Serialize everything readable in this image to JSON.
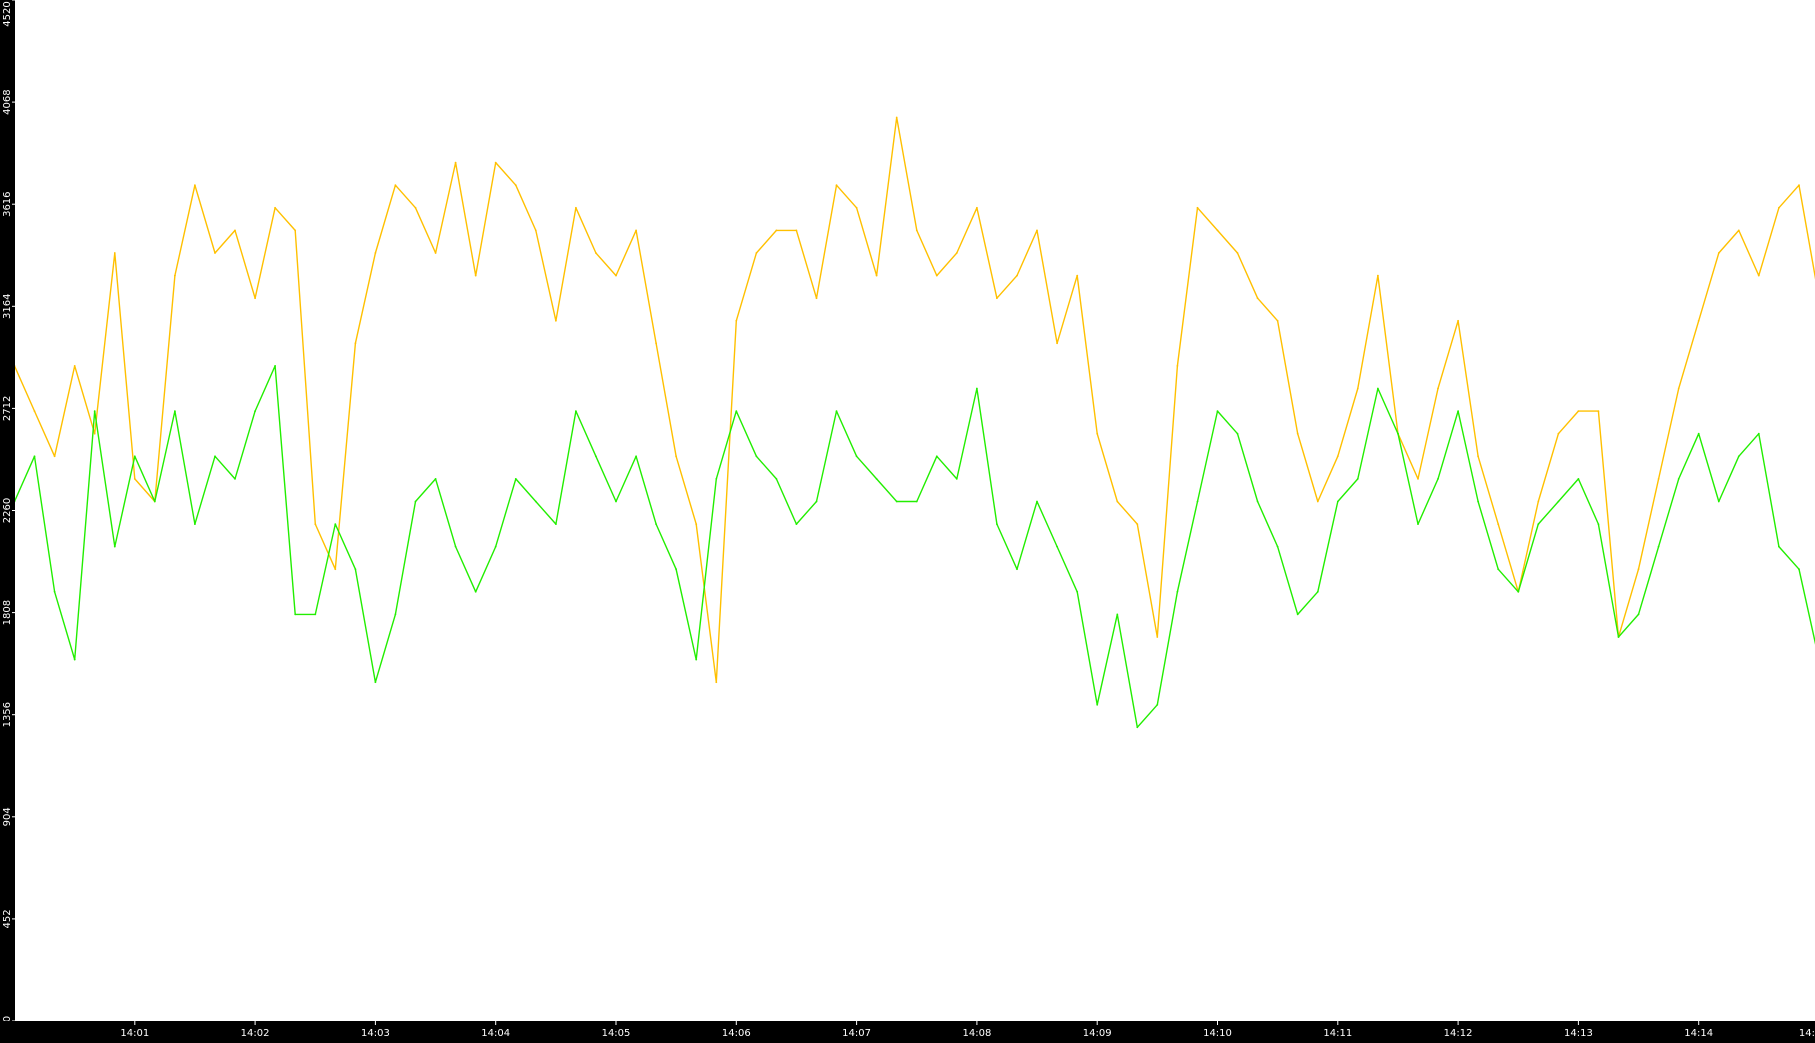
{
  "chart_data": {
    "type": "line",
    "title": "",
    "xlabel": "",
    "ylabel": "",
    "ylim": [
      0,
      4520
    ],
    "xlim": [
      "14:00:00",
      "14:15:00"
    ],
    "grid": false,
    "legend": "none",
    "y_ticks": [
      "0",
      "452",
      "904",
      "1356",
      "1808",
      "2260",
      "2712",
      "3164",
      "3616",
      "4068",
      "4520"
    ],
    "y_tick_values": [
      0,
      452,
      904,
      1356,
      1808,
      2260,
      2712,
      3164,
      3616,
      4068,
      4520
    ],
    "x_ticks": [
      "14:01",
      "14:02",
      "14:03",
      "14:04",
      "14:05",
      "14:06",
      "14:07",
      "14:08",
      "14:09",
      "14:10",
      "14:11",
      "14:12",
      "14:13",
      "14:14",
      "14:"
    ],
    "x_tick_times": [
      "14:01:00",
      "14:02:00",
      "14:03:00",
      "14:04:00",
      "14:05:00",
      "14:06:00",
      "14:07:00",
      "14:08:00",
      "14:09:00",
      "14:10:00",
      "14:11:00",
      "14:12:00",
      "14:13:00",
      "14:14:00",
      "14:15:00"
    ],
    "x": [
      "14:00:00",
      "14:00:10",
      "14:00:20",
      "14:00:30",
      "14:00:40",
      "14:00:50",
      "14:01:00",
      "14:01:10",
      "14:01:20",
      "14:01:30",
      "14:01:40",
      "14:01:50",
      "14:02:00",
      "14:02:10",
      "14:02:20",
      "14:02:30",
      "14:02:40",
      "14:02:50",
      "14:03:00",
      "14:03:10",
      "14:03:20",
      "14:03:30",
      "14:03:40",
      "14:03:50",
      "14:04:00",
      "14:04:10",
      "14:04:20",
      "14:04:30",
      "14:04:40",
      "14:04:50",
      "14:05:00",
      "14:05:10",
      "14:05:20",
      "14:05:30",
      "14:05:40",
      "14:05:50",
      "14:06:00",
      "14:06:10",
      "14:06:20",
      "14:06:30",
      "14:06:40",
      "14:06:50",
      "14:07:00",
      "14:07:10",
      "14:07:20",
      "14:07:30",
      "14:07:40",
      "14:07:50",
      "14:08:00",
      "14:08:10",
      "14:08:20",
      "14:08:30",
      "14:08:40",
      "14:08:50",
      "14:09:00",
      "14:09:10",
      "14:09:20",
      "14:09:30",
      "14:09:40",
      "14:09:50",
      "14:10:00",
      "14:10:10",
      "14:10:20",
      "14:10:30",
      "14:10:40",
      "14:10:50",
      "14:11:00",
      "14:11:10",
      "14:11:20",
      "14:11:30",
      "14:11:40",
      "14:11:50",
      "14:12:00",
      "14:12:10",
      "14:12:20",
      "14:12:30",
      "14:12:40",
      "14:12:50",
      "14:13:00",
      "14:13:10",
      "14:13:20",
      "14:13:30",
      "14:13:40",
      "14:13:50",
      "14:14:00",
      "14:14:10",
      "14:14:20",
      "14:14:30",
      "14:14:40",
      "14:14:50",
      "14:15:00"
    ],
    "series": [
      {
        "color": "#ffc000",
        "values": [
          2900,
          2700,
          2500,
          2900,
          2600,
          3400,
          2400,
          2300,
          3300,
          3700,
          3400,
          3500,
          3200,
          3600,
          3500,
          2200,
          2000,
          3000,
          3400,
          3700,
          3600,
          3400,
          3800,
          3300,
          3800,
          3700,
          3500,
          3100,
          3600,
          3400,
          3300,
          3500,
          3000,
          2500,
          2200,
          1500,
          3100,
          3400,
          3500,
          3500,
          3200,
          3700,
          3600,
          3300,
          4000,
          3500,
          3300,
          3400,
          3600,
          3200,
          3300,
          3500,
          3000,
          3300,
          2600,
          2300,
          2200,
          1700,
          2900,
          3600,
          3500,
          3400,
          3200,
          3100,
          2600,
          2300,
          2500,
          2800,
          3300,
          2600,
          2400,
          2800,
          3100,
          2500,
          2200,
          1900,
          2300,
          2600,
          2700,
          2700,
          1700,
          2000,
          2400,
          2800,
          3100,
          3400,
          3500,
          3300,
          3600,
          3700,
          3200
        ]
      },
      {
        "color": "#22ee00",
        "values": [
          2300,
          2500,
          1900,
          1600,
          2700,
          2100,
          2500,
          2300,
          2700,
          2200,
          2500,
          2400,
          2700,
          2900,
          1800,
          1800,
          2200,
          2000,
          1500,
          1800,
          2300,
          2400,
          2100,
          1900,
          2100,
          2400,
          2300,
          2200,
          2700,
          2500,
          2300,
          2500,
          2200,
          2000,
          1600,
          2400,
          2700,
          2500,
          2400,
          2200,
          2300,
          2700,
          2500,
          2400,
          2300,
          2300,
          2500,
          2400,
          2800,
          2200,
          2000,
          2300,
          2100,
          1900,
          1400,
          1800,
          1300,
          1400,
          1900,
          2300,
          2700,
          2600,
          2300,
          2100,
          1800,
          1900,
          2300,
          2400,
          2800,
          2600,
          2200,
          2400,
          2700,
          2300,
          2000,
          1900,
          2200,
          2300,
          2400,
          2200,
          1700,
          1800,
          2100,
          2400,
          2600,
          2300,
          2500,
          2600,
          2100,
          2000,
          1600
        ]
      }
    ]
  }
}
